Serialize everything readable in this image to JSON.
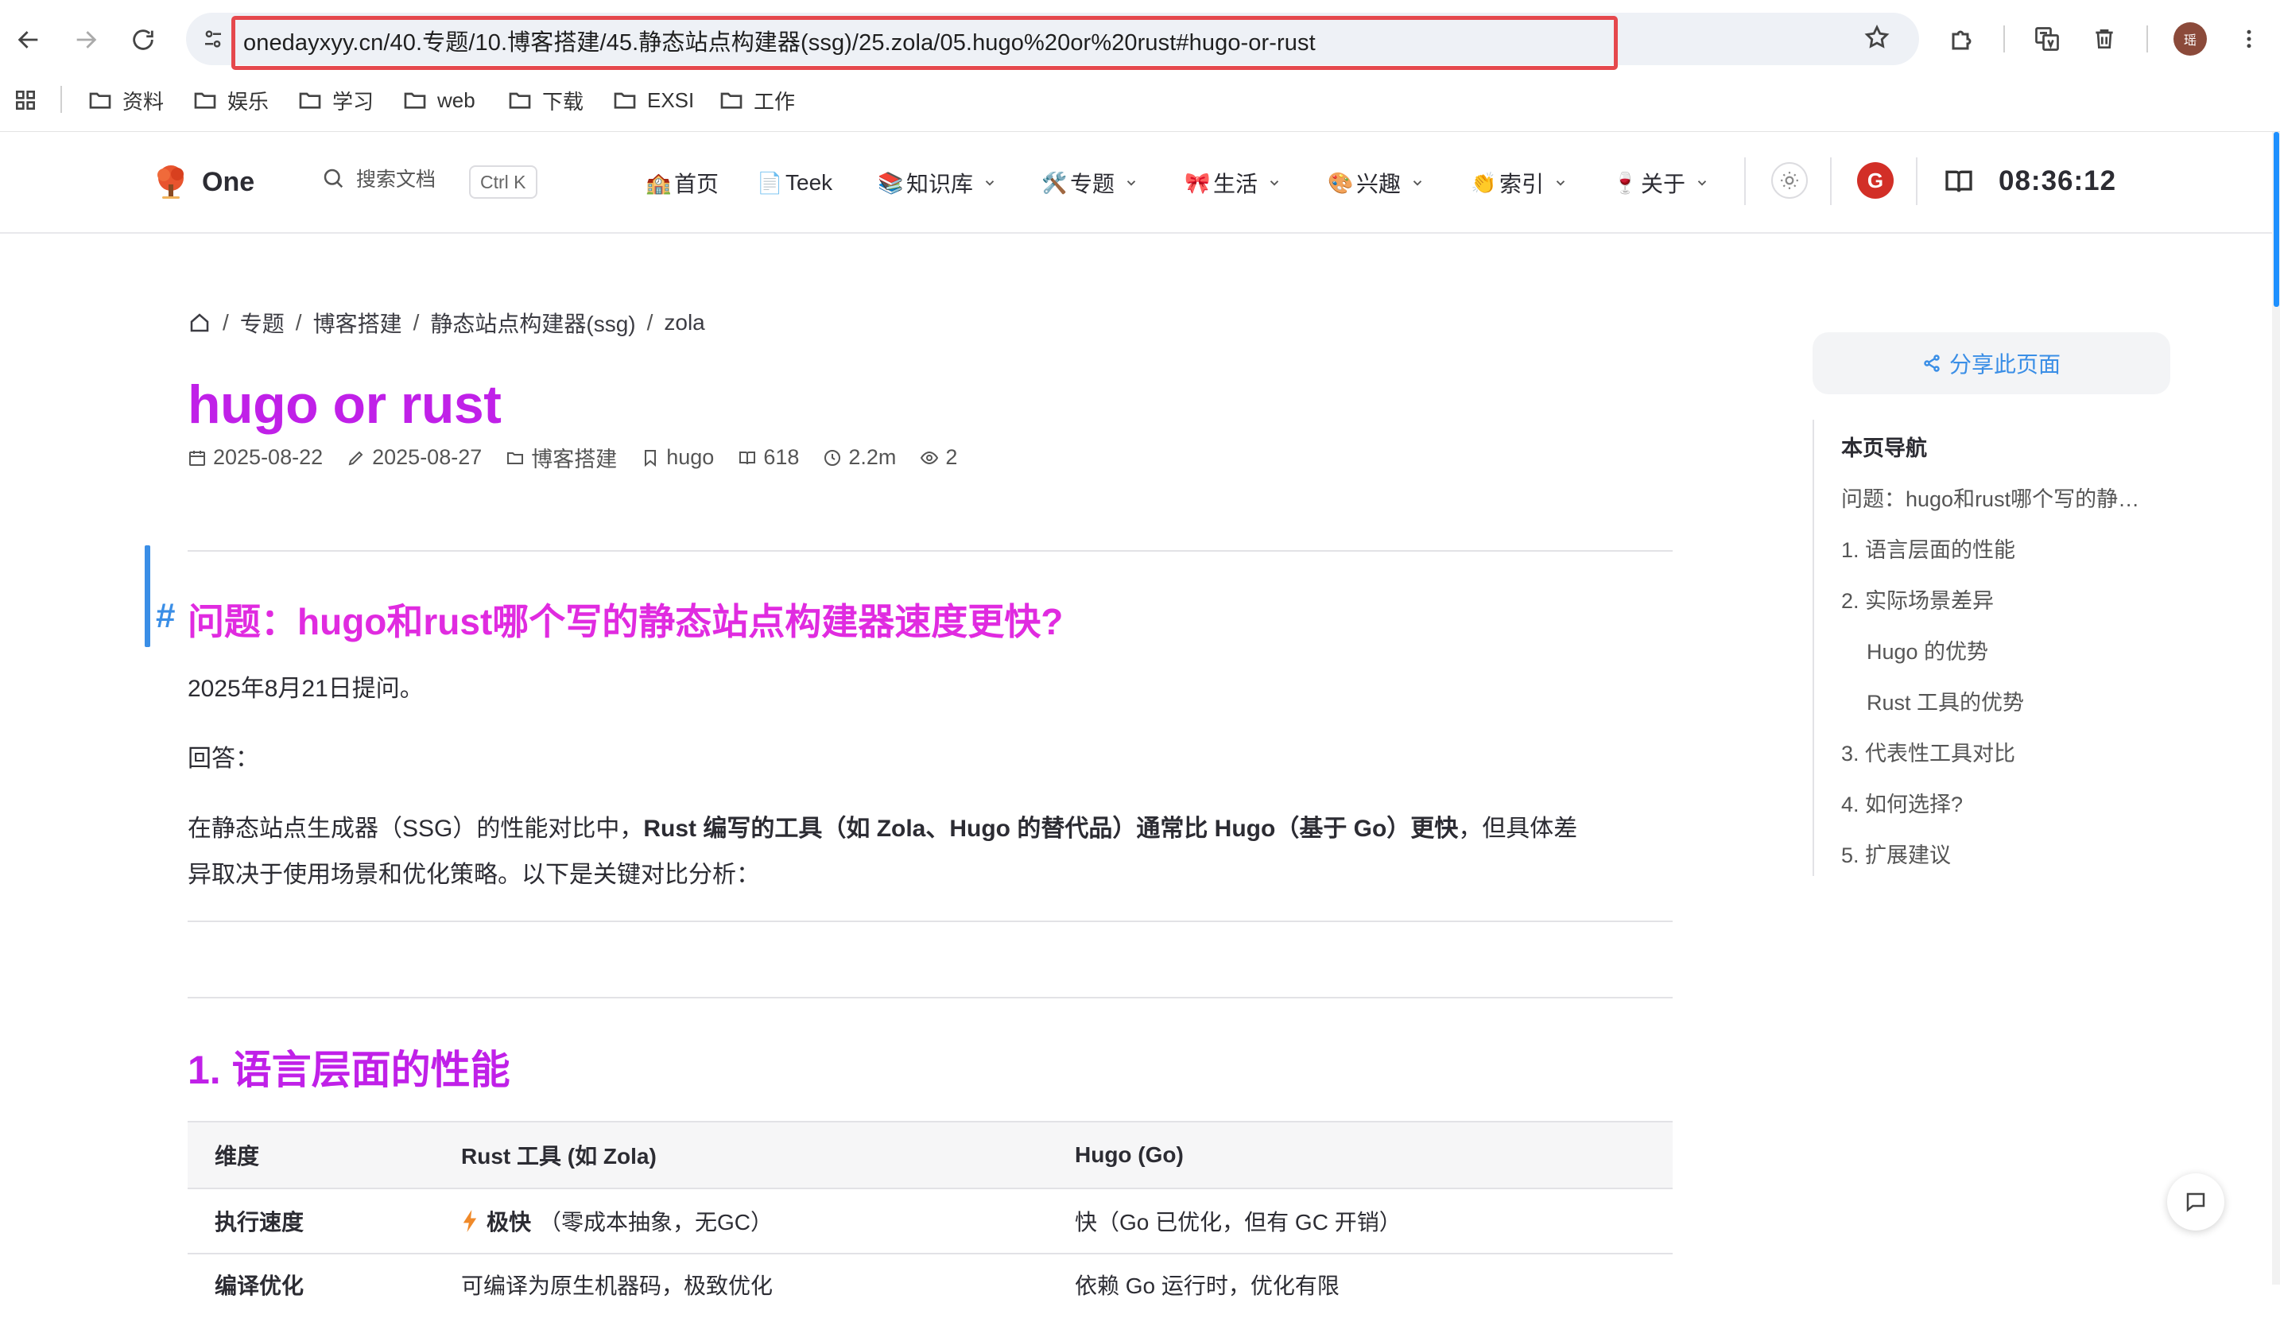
{
  "browser": {
    "url": "onedayxyy.cn/40.专题/10.博客搭建/45.静态站点构建器(ssg)/25.zola/05.hugo%20or%20rust#hugo-or-rust",
    "profile_initial": "瑶",
    "bookmarks": [
      "资料",
      "娱乐",
      "学习",
      "web",
      "下载",
      "EXSI",
      "工作"
    ]
  },
  "header": {
    "logo_text": "One",
    "search_label": "搜索文档",
    "search_shortcut": "Ctrl K",
    "nav": [
      {
        "emoji": "🏫",
        "label": "首页"
      },
      {
        "emoji": "📄",
        "label": "Teek"
      },
      {
        "emoji": "📚",
        "label": "知识库"
      },
      {
        "emoji": "🛠️",
        "label": "专题"
      },
      {
        "emoji": "🎀",
        "label": "生活"
      },
      {
        "emoji": "🎨",
        "label": "兴趣"
      },
      {
        "emoji": "👏",
        "label": "索引"
      },
      {
        "emoji": "🍷",
        "label": "关于"
      }
    ],
    "gh_letter": "G",
    "clock": "08:36:12"
  },
  "breadcrumb": [
    "专题",
    "博客搭建",
    "静态站点构建器(ssg)",
    "zola"
  ],
  "article": {
    "title": "hugo or rust",
    "meta": {
      "created": "2025-08-22",
      "updated": "2025-08-27",
      "category": "博客搭建",
      "tag": "hugo",
      "words": "618",
      "read_time": "2.2m",
      "views": "2"
    },
    "h2_question": "问题：hugo和rust哪个写的静态站点构建器速度更快?",
    "asked_on": "2025年8月21日提问。",
    "answer_label": "回答：",
    "intro_prefix": "在静态站点生成器（SSG）的性能对比中，",
    "intro_bold": "Rust 编写的工具（如 Zola、Hugo 的替代品）通常比 Hugo（基于 Go）更快",
    "intro_suffix": "，但具体差",
    "intro_line2": "异取决于使用场景和优化策略。以下是关键对比分析：",
    "h2_perf": "1. 语言层面的性能",
    "table": {
      "headers": [
        "维度",
        "Rust 工具 (如 Zola)",
        "Hugo (Go)"
      ],
      "rows": [
        {
          "dim": "执行速度",
          "rust_bold": "极快",
          "rust": "（零成本抽象，无GC）",
          "go": "快（Go 已优化，但有 GC 开销）"
        },
        {
          "dim": "编译优化",
          "rust_bold": "",
          "rust": "可编译为原生机器码，极致优化",
          "go": "依赖 Go 运行时，优化有限"
        }
      ]
    }
  },
  "aside": {
    "share_label": "分享此页面",
    "toc_title": "本页导航",
    "toc": [
      "问题：hugo和rust哪个写的静…",
      "1. 语言层面的性能",
      "2. 实际场景差异",
      "Hugo 的优势",
      "Rust 工具的优势",
      "3. 代表性工具对比",
      "4. 如何选择?",
      "5. 扩展建议"
    ]
  }
}
